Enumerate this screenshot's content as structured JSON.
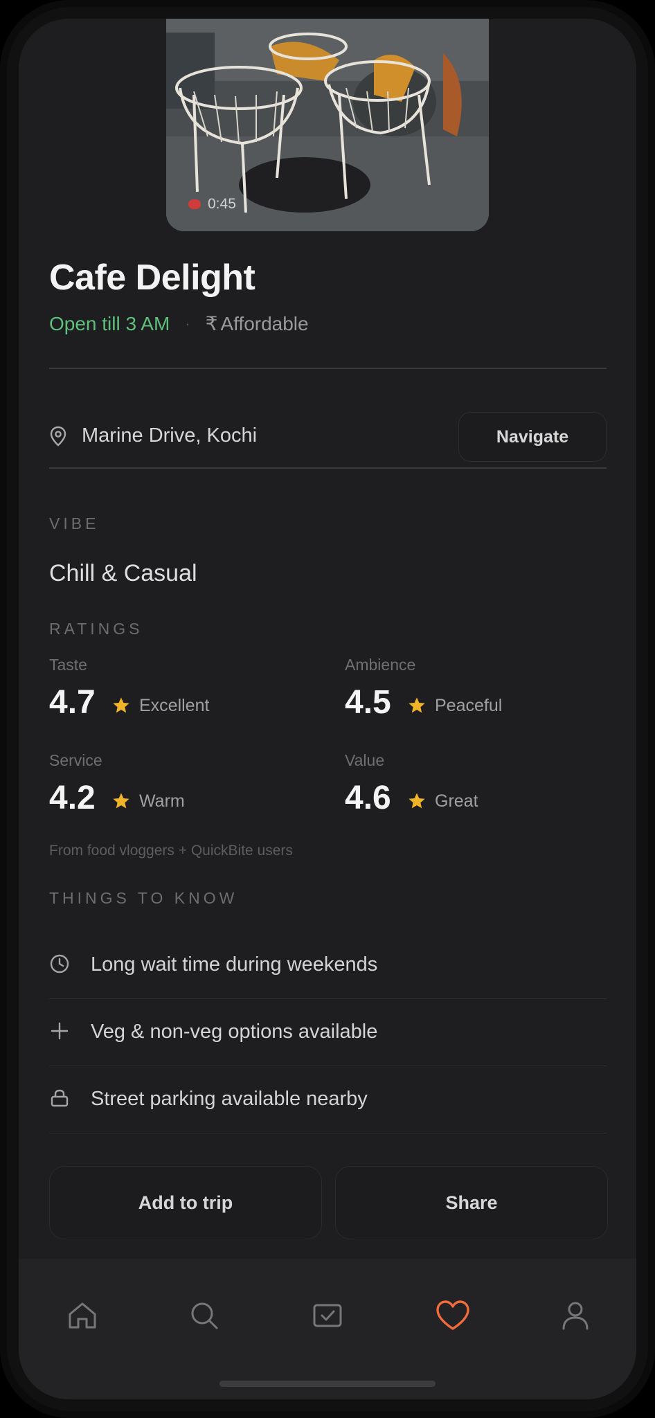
{
  "video": {
    "duration": "0:45"
  },
  "place": {
    "name": "Cafe Delight",
    "hours": "Open till 3 AM",
    "separator": "·",
    "price_symbol": "₹",
    "price": "Affordable"
  },
  "location": {
    "address": "Marine Drive, Kochi",
    "navigate_label": "Navigate"
  },
  "vibe": {
    "section": "VIBE",
    "value": "Chill & Casual"
  },
  "ratings": {
    "section": "RATINGS",
    "items": [
      {
        "label": "Taste",
        "score": "4.7",
        "desc": "Excellent"
      },
      {
        "label": "Ambience",
        "score": "4.5",
        "desc": "Peaceful"
      },
      {
        "label": "Service",
        "score": "4.2",
        "desc": "Warm"
      },
      {
        "label": "Value",
        "score": "4.6",
        "desc": "Great"
      }
    ],
    "source": "From food vloggers + QuickBite users"
  },
  "things_to_know": {
    "section": "THINGS TO KNOW",
    "items": [
      {
        "icon": "clock-icon",
        "text": "Long wait time during weekends"
      },
      {
        "icon": "plus-icon",
        "text": "Veg & non-veg options available"
      },
      {
        "icon": "lock-icon",
        "text": "Street parking available nearby"
      }
    ]
  },
  "actions": {
    "add_to_trip": "Add to trip",
    "share": "Share"
  },
  "tabs": [
    {
      "name": "home",
      "icon": "home-icon"
    },
    {
      "name": "search",
      "icon": "search-icon"
    },
    {
      "name": "trips",
      "icon": "checklist-icon"
    },
    {
      "name": "saved",
      "icon": "heart-icon",
      "active": true
    },
    {
      "name": "profile",
      "icon": "user-icon"
    }
  ],
  "colors": {
    "open": "#5fbf7c",
    "star": "#f0b429",
    "active_tab": "#f26b3a",
    "background": "#1e1e20"
  }
}
